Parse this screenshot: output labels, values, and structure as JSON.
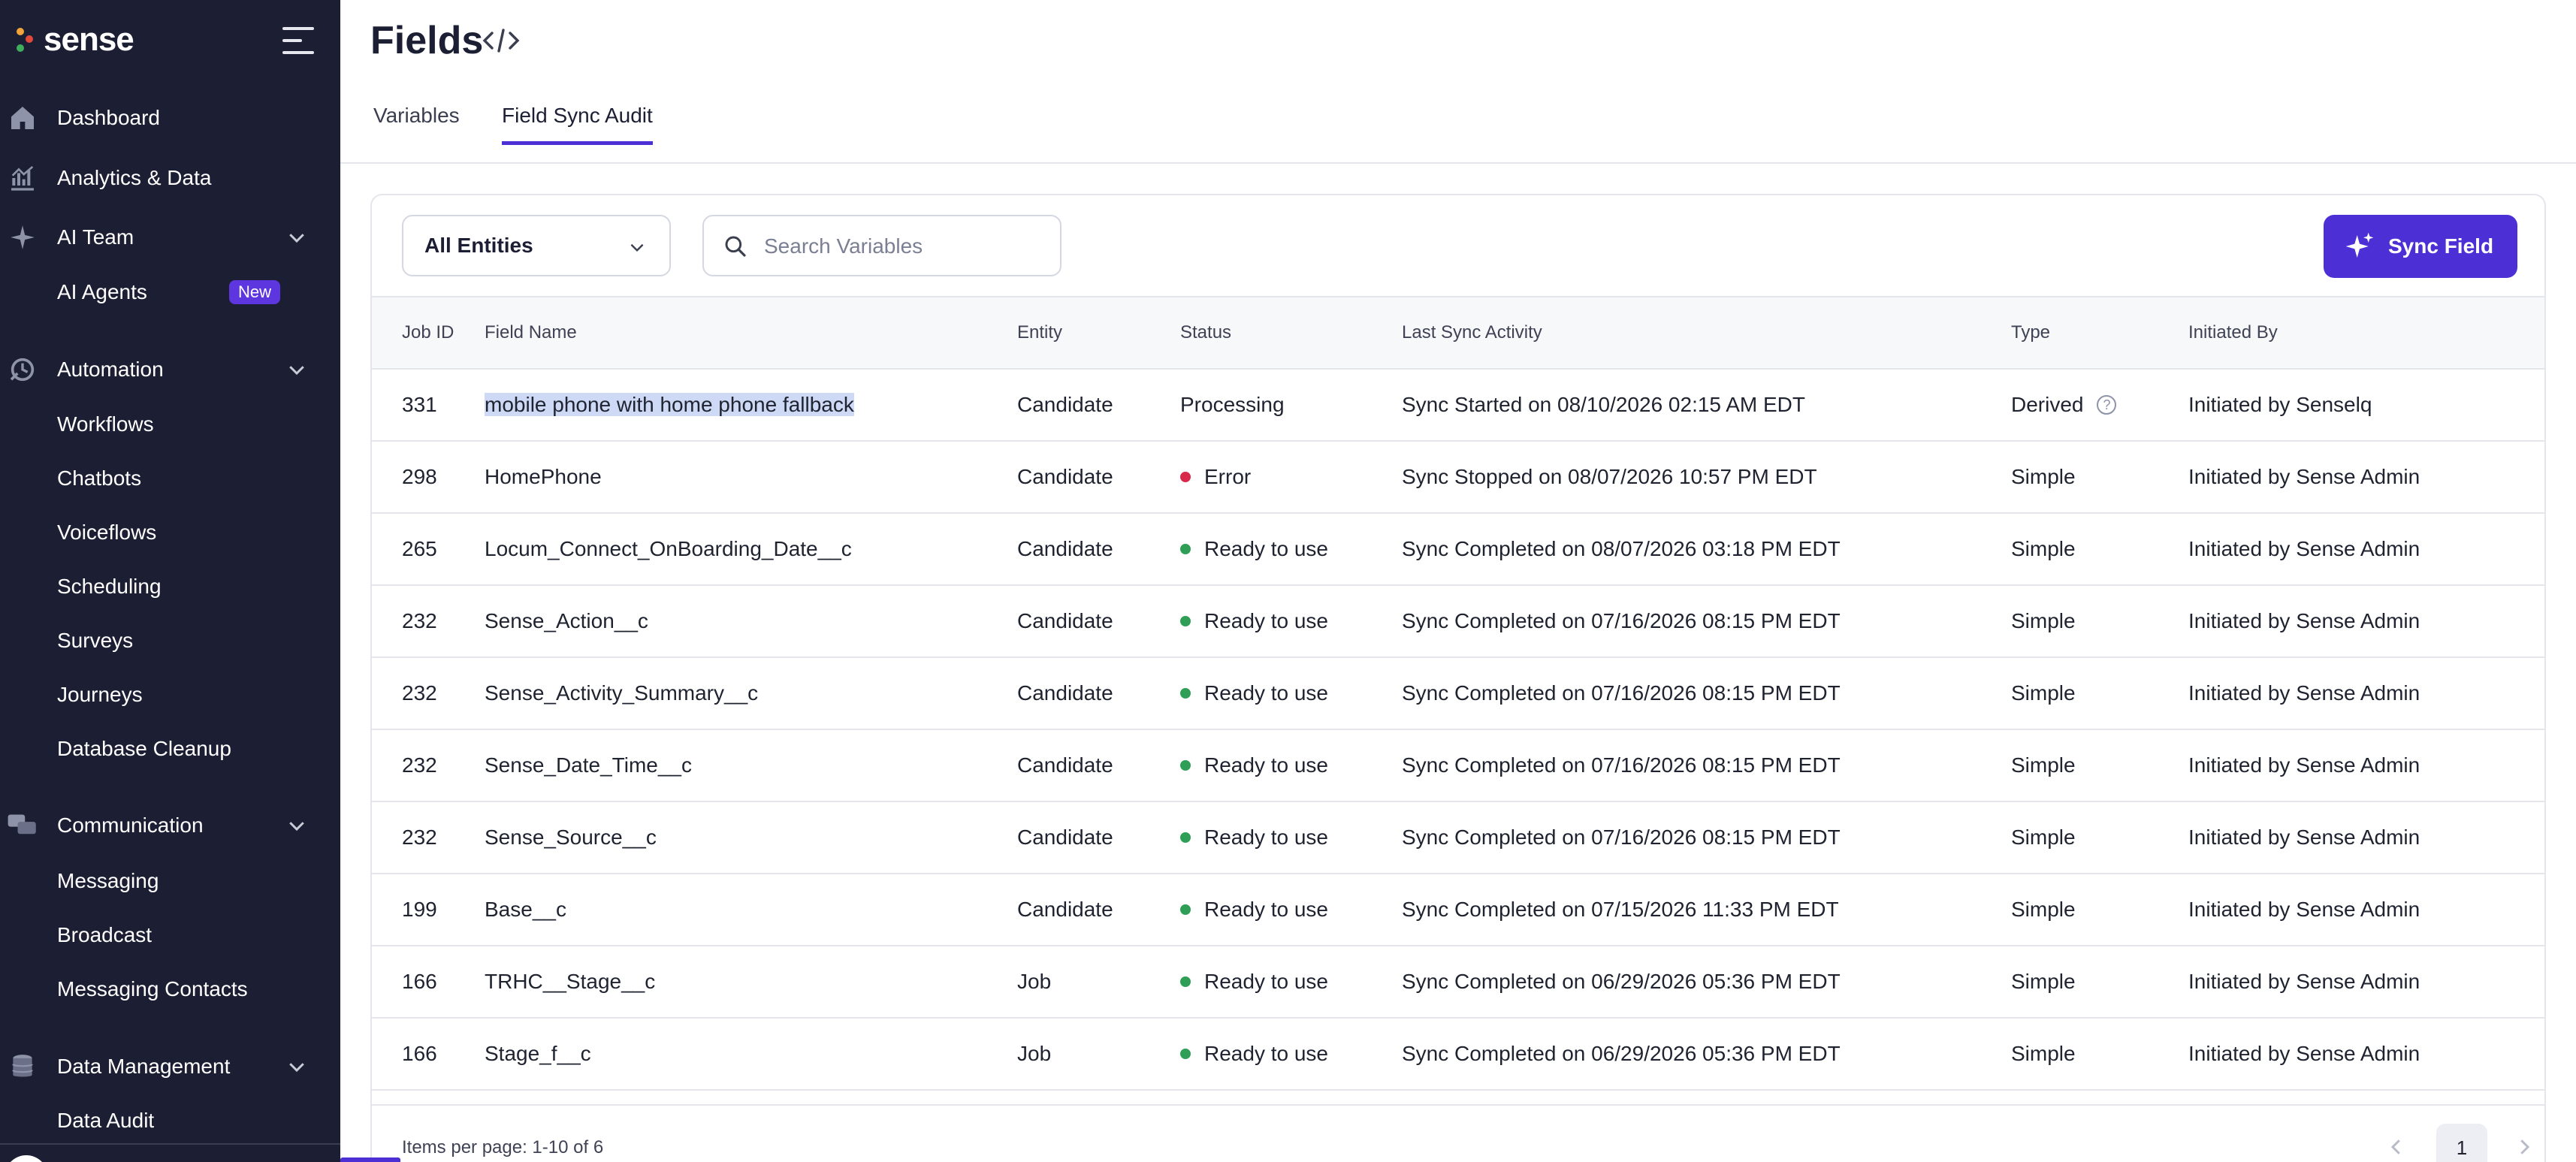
{
  "brand": {
    "name": "sense"
  },
  "sidebar": {
    "dashboard": "Dashboard",
    "analytics": "Analytics & Data",
    "ai_team": "AI Team",
    "ai_agents": "AI Agents",
    "new_badge": "New",
    "automation": "Automation",
    "workflows": "Workflows",
    "chatbots": "Chatbots",
    "voiceflows": "Voiceflows",
    "scheduling": "Scheduling",
    "surveys": "Surveys",
    "journeys": "Journeys",
    "database_cleanup": "Database Cleanup",
    "communication": "Communication",
    "messaging": "Messaging",
    "broadcast": "Broadcast",
    "messaging_contacts": "Messaging Contacts",
    "data_management": "Data Management",
    "data_audit": "Data Audit"
  },
  "page": {
    "title": "Fields"
  },
  "tabs": [
    {
      "label": "Variables",
      "active": false
    },
    {
      "label": "Field Sync Audit",
      "active": true
    }
  ],
  "filters": {
    "entity_select": "All Entities",
    "search_placeholder": "Search Variables",
    "sync_button": "Sync Field"
  },
  "table": {
    "headers": {
      "job_id": "Job ID",
      "field_name": "Field Name",
      "entity": "Entity",
      "status": "Status",
      "last_sync": "Last Sync Activity",
      "type": "Type",
      "initiated_by": "Initiated By"
    },
    "rows": [
      {
        "job_id": "331",
        "field_name": "mobile phone with home phone fallback",
        "entity": "Candidate",
        "status": "Processing",
        "last_sync": "Sync Started on 08/10/2026 02:15 AM EDT",
        "type": "Derived",
        "initiated_by": "Initiated by Senselq"
      },
      {
        "job_id": "298",
        "field_name": "HomePhone",
        "entity": "Candidate",
        "status": "Error",
        "last_sync": "Sync Stopped on 08/07/2026 10:57 PM EDT",
        "type": "Simple",
        "initiated_by": "Initiated by Sense Admin"
      },
      {
        "job_id": "265",
        "field_name": "Locum_Connect_OnBoarding_Date__c",
        "entity": "Candidate",
        "status": "Ready to use",
        "last_sync": "Sync Completed on 08/07/2026 03:18 PM EDT",
        "type": "Simple",
        "initiated_by": "Initiated by Sense Admin"
      },
      {
        "job_id": "232",
        "field_name": "Sense_Action__c",
        "entity": "Candidate",
        "status": "Ready to use",
        "last_sync": "Sync Completed on 07/16/2026 08:15 PM EDT",
        "type": "Simple",
        "initiated_by": "Initiated by Sense Admin"
      },
      {
        "job_id": "232",
        "field_name": "Sense_Activity_Summary__c",
        "entity": "Candidate",
        "status": "Ready to use",
        "last_sync": "Sync Completed on 07/16/2026 08:15 PM EDT",
        "type": "Simple",
        "initiated_by": "Initiated by Sense Admin"
      },
      {
        "job_id": "232",
        "field_name": "Sense_Date_Time__c",
        "entity": "Candidate",
        "status": "Ready to use",
        "last_sync": "Sync Completed on 07/16/2026 08:15 PM EDT",
        "type": "Simple",
        "initiated_by": "Initiated by Sense Admin"
      },
      {
        "job_id": "232",
        "field_name": "Sense_Source__c",
        "entity": "Candidate",
        "status": "Ready to use",
        "last_sync": "Sync Completed on 07/16/2026 08:15 PM EDT",
        "type": "Simple",
        "initiated_by": "Initiated by Sense Admin"
      },
      {
        "job_id": "199",
        "field_name": "Base__c",
        "entity": "Candidate",
        "status": "Ready to use",
        "last_sync": "Sync Completed on 07/15/2026 11:33 PM EDT",
        "type": "Simple",
        "initiated_by": "Initiated by Sense Admin"
      },
      {
        "job_id": "166",
        "field_name": "TRHC__Stage__c",
        "entity": "Job",
        "status": "Ready to use",
        "last_sync": "Sync Completed on 06/29/2026 05:36 PM EDT",
        "type": "Simple",
        "initiated_by": "Initiated by Sense Admin"
      },
      {
        "job_id": "166",
        "field_name": "Stage_f__c",
        "entity": "Job",
        "status": "Ready to use",
        "last_sync": "Sync Completed on 06/29/2026 05:36 PM EDT",
        "type": "Simple",
        "initiated_by": "Initiated by Sense Admin"
      }
    ]
  },
  "pagination": {
    "summary": "Items per page: 1-10 of 6",
    "current_page": "1"
  },
  "colors": {
    "sidebar_bg": "#1c1f33",
    "accent": "#4d2fd6",
    "status_ready": "#2f9e56",
    "status_error": "#d9294b",
    "highlight": "#cdd9f5"
  }
}
